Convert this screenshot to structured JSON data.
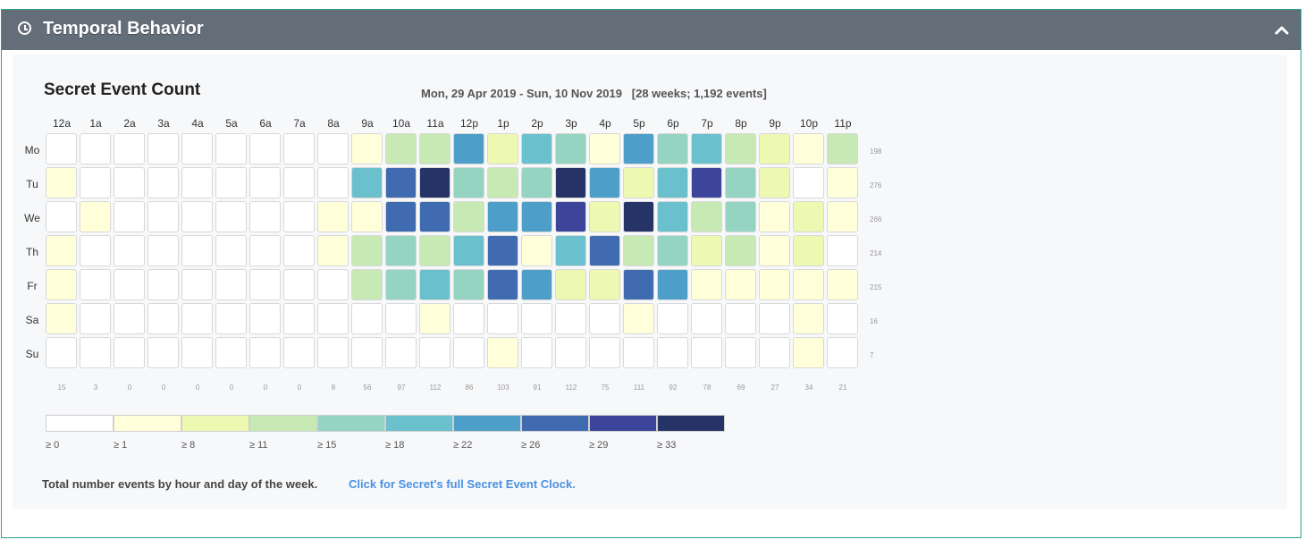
{
  "panel": {
    "title": "Temporal Behavior",
    "clock_icon": "clock-icon",
    "collapse_icon": "chevron-up-icon"
  },
  "chart_data": {
    "type": "heatmap",
    "title": "Secret Event Count",
    "range": "Mon, 29 Apr 2019 - Sun, 10 Nov 2019   [28 weeks; 1,192 events]",
    "hours": [
      "12a",
      "1a",
      "2a",
      "3a",
      "4a",
      "5a",
      "6a",
      "7a",
      "8a",
      "9a",
      "10a",
      "11a",
      "12p",
      "1p",
      "2p",
      "3p",
      "4p",
      "5p",
      "6p",
      "7p",
      "8p",
      "9p",
      "10p",
      "11p"
    ],
    "days": [
      "Mo",
      "Tu",
      "We",
      "Th",
      "Fr",
      "Sa",
      "Su"
    ],
    "row_totals": [
      "198",
      "276",
      "266",
      "214",
      "215",
      "16",
      "7"
    ],
    "col_totals": [
      "15",
      "3",
      "0",
      "0",
      "0",
      "0",
      "0",
      "0",
      "8",
      "56",
      "97",
      "112",
      "86",
      "103",
      "91",
      "112",
      "75",
      "111",
      "92",
      "78",
      "69",
      "27",
      "34",
      "21"
    ],
    "levels": [
      [
        0,
        0,
        0,
        0,
        0,
        0,
        0,
        0,
        0,
        1,
        3,
        3,
        6,
        2,
        5,
        4,
        1,
        6,
        4,
        5,
        3,
        2,
        1,
        3
      ],
      [
        1,
        0,
        0,
        0,
        0,
        0,
        0,
        0,
        0,
        5,
        7,
        9,
        4,
        3,
        4,
        9,
        6,
        2,
        5,
        8,
        4,
        2,
        0,
        1
      ],
      [
        0,
        1,
        0,
        0,
        0,
        0,
        0,
        0,
        1,
        1,
        7,
        7,
        3,
        6,
        6,
        8,
        2,
        9,
        5,
        3,
        4,
        1,
        2,
        1
      ],
      [
        1,
        0,
        0,
        0,
        0,
        0,
        0,
        0,
        1,
        3,
        4,
        3,
        5,
        7,
        1,
        5,
        7,
        3,
        4,
        2,
        3,
        1,
        2,
        0
      ],
      [
        1,
        0,
        0,
        0,
        0,
        0,
        0,
        0,
        0,
        3,
        4,
        5,
        4,
        7,
        6,
        2,
        2,
        7,
        6,
        1,
        1,
        1,
        1,
        1
      ],
      [
        1,
        0,
        0,
        0,
        0,
        0,
        0,
        0,
        0,
        0,
        0,
        1,
        0,
        0,
        0,
        0,
        0,
        1,
        0,
        0,
        0,
        0,
        1,
        0
      ],
      [
        0,
        0,
        0,
        0,
        0,
        0,
        0,
        0,
        0,
        0,
        0,
        0,
        0,
        1,
        0,
        0,
        0,
        0,
        0,
        0,
        0,
        0,
        1,
        0
      ]
    ],
    "legend": {
      "colors": [
        "#ffffff",
        "#ffffd9",
        "#edf8b1",
        "#c7e9b4",
        "#94d4c1",
        "#6ac0cc",
        "#4d9ec8",
        "#416bb0",
        "#3c459a",
        "#253366"
      ],
      "labels": [
        "≥ 0",
        "≥ 1",
        "≥ 8",
        "≥ 11",
        "≥ 15",
        "≥ 18",
        "≥ 22",
        "≥ 26",
        "≥ 29",
        "≥ 33"
      ]
    }
  },
  "footer": {
    "text": "Total number events by hour and day of the week.",
    "link": "Click for Secret's full Secret Event Clock."
  }
}
